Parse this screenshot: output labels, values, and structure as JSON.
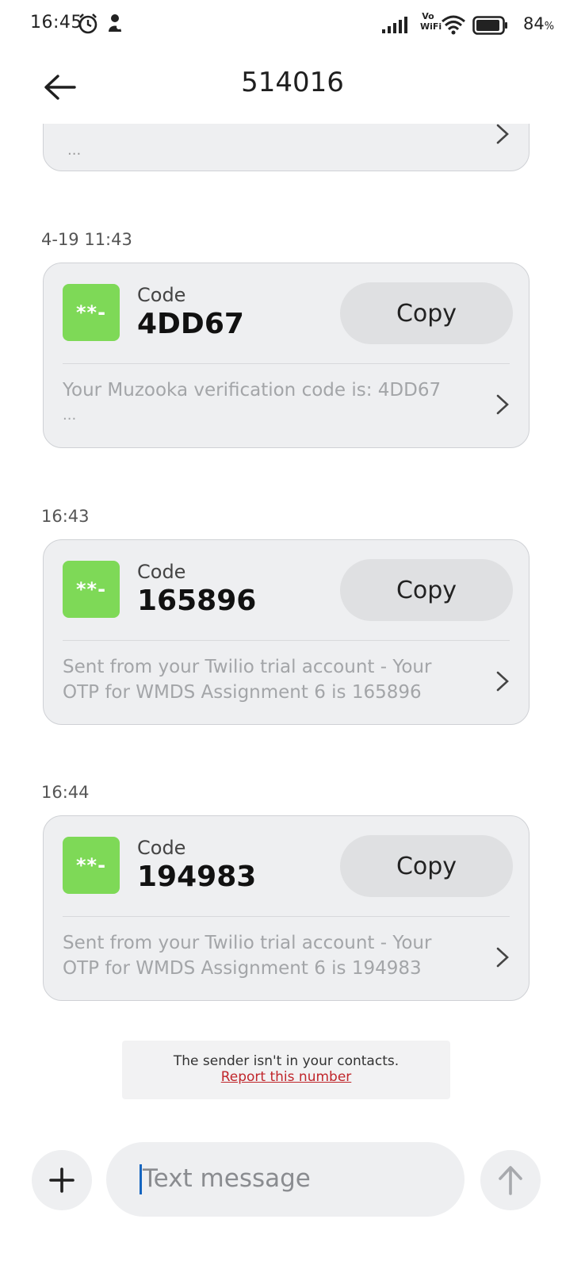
{
  "status_bar": {
    "time": "16:45",
    "network": "Vo WiFi",
    "battery": "84",
    "battery_unit": "%"
  },
  "header": {
    "title": "514016"
  },
  "partial_card": {
    "ellipsis": "..."
  },
  "messages": [
    {
      "timestamp": "4-19 11:43",
      "code_label": "Code",
      "code": "4DD67",
      "copy_label": "Copy",
      "tile": "**-",
      "preview": "Your Muzooka verification code is: 4DD67",
      "ellipsis": "..."
    },
    {
      "timestamp": "16:43",
      "code_label": "Code",
      "code": "165896",
      "copy_label": "Copy",
      "tile": "**-",
      "preview": "Sent from your Twilio trial account - Your OTP for WMDS Assignment 6 is 165896"
    },
    {
      "timestamp": "16:44",
      "code_label": "Code",
      "code": "194983",
      "copy_label": "Copy",
      "tile": "**-",
      "preview": "Sent from your Twilio trial account - Your OTP for WMDS Assignment 6 is 194983"
    }
  ],
  "notice": {
    "text": "The sender isn't in your contacts.",
    "link": "Report this number"
  },
  "composer": {
    "placeholder": "Text message"
  },
  "colors": {
    "otp_tile": "#7ed957",
    "card_bg": "#eeeff1",
    "report_link": "#c0262b",
    "cursor": "#1565c0"
  }
}
